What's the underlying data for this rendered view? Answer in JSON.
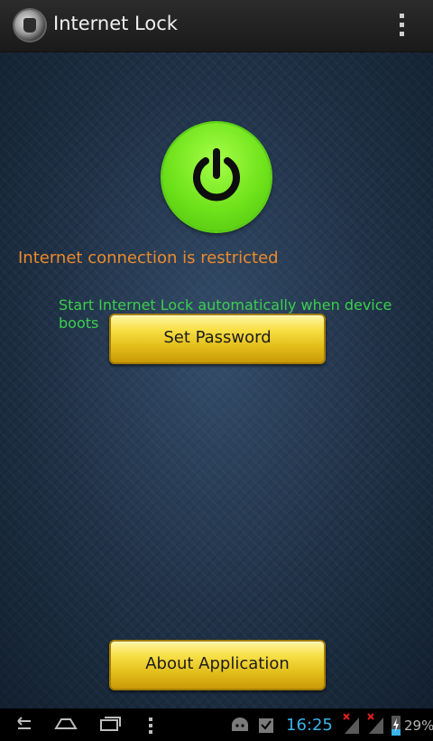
{
  "app": {
    "title": "Internet Lock",
    "icon": "app-logo-icon"
  },
  "main": {
    "status_text": "Internet connection is restricted",
    "status_color": "#ee8a2a",
    "autostart_label": "Start Internet Lock automatically when device boots",
    "autostart_color": "#3ccf4e",
    "power_button_color": "#6ee21b",
    "set_password_label": "Set Password",
    "about_label": "About Application"
  },
  "statusbar": {
    "time": "16:25",
    "battery": "29%",
    "accent": "#38b3e8"
  }
}
